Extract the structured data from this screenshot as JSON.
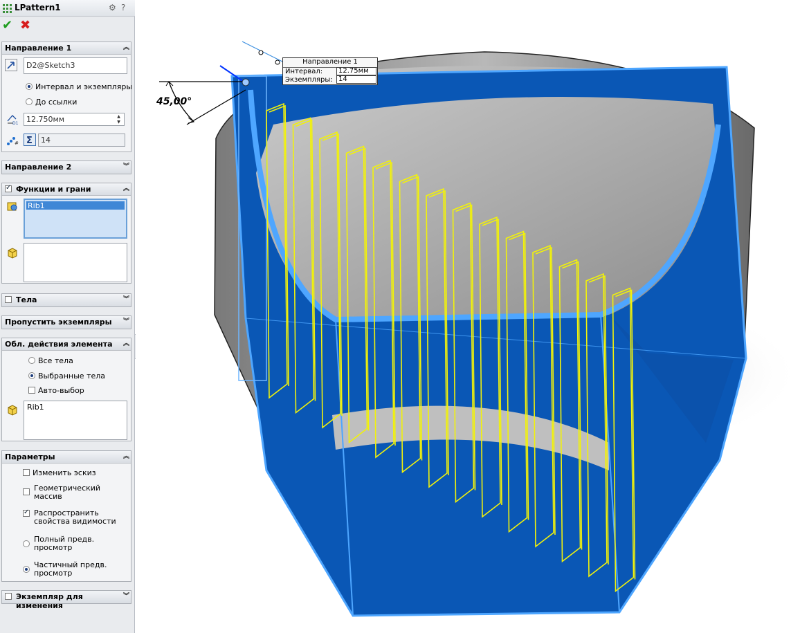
{
  "title": "LPattern1",
  "header_icons": [
    "feature-help-icon",
    "help-question-icon"
  ],
  "ok_label": "✔",
  "cancel_label": "✖",
  "direction1": {
    "label": "Направление 1",
    "reference": "D2@Sketch3",
    "option_spacing": "Интервал и экземпляры",
    "option_to_reference": "До ссылки",
    "spacing_value": "12.750мм",
    "instances_value": "14"
  },
  "direction2": {
    "label": "Направление 2"
  },
  "features": {
    "label": "Функции и грани",
    "checked": true,
    "feature_list": [
      "Rib1"
    ],
    "faces_list": []
  },
  "bodies": {
    "label": "Тела",
    "checked": false
  },
  "skip_instances": {
    "label": "Пропустить экземпляры"
  },
  "feature_scope": {
    "label": "Обл. действия элемента",
    "all_bodies": "Все тела",
    "selected_bodies": "Выбранные тела",
    "auto_select": "Авто-выбор",
    "bodies_list": [
      "Rib1"
    ]
  },
  "options": {
    "label": "Параметры",
    "vary_sketch": "Изменить эскиз",
    "geometry_pattern_l1": "Геометрический",
    "geometry_pattern_l2": "массив",
    "propagate_l1": "Распространить",
    "propagate_l2": "свойства видимости",
    "full_preview_l1": "Полный предв.",
    "full_preview_l2": "просмотр",
    "partial_preview_l1": "Частичный предв.",
    "partial_preview_l2": "просмотр"
  },
  "instances_to_vary": {
    "label": "Экземпляр для изменения",
    "checked": false
  },
  "callout": {
    "title": "Направление 1",
    "spacing_label": "Интервал:",
    "spacing_value": "12.75мм",
    "instances_label": "Экземпляры:",
    "instances_value": "14"
  },
  "angle_dimension": "45,00°",
  "preview_rib_count": 14,
  "colors": {
    "part_blue": "#0a57b5",
    "edge_highlight": "#4ea6ff",
    "preview_yellow": "#f2f20a",
    "gray_body": "#9c9c9c"
  }
}
